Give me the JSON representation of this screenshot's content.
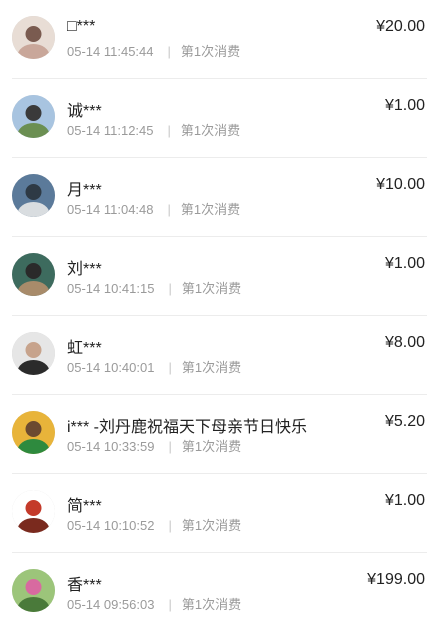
{
  "records": [
    {
      "name": "□***",
      "time": "05-14 11:45:44",
      "sep": "|",
      "count": "第1次消费",
      "amount": "¥20.00",
      "avatar_icon": "user-photo-icon",
      "avatar_colors": [
        "#e8ddd5",
        "#c9a79a",
        "#7a5b50"
      ]
    },
    {
      "name": "诚***",
      "time": "05-14 11:12:45",
      "sep": "|",
      "count": "第1次消费",
      "amount": "¥1.00",
      "avatar_icon": "user-photo-icon",
      "avatar_colors": [
        "#a8c4e0",
        "#6b8f52",
        "#3a3a3a"
      ]
    },
    {
      "name": "月***",
      "time": "05-14 11:04:48",
      "sep": "|",
      "count": "第1次消费",
      "amount": "¥10.00",
      "avatar_icon": "tree-photo-icon",
      "avatar_colors": [
        "#5b7a9a",
        "#d9dde0",
        "#2e3a45"
      ]
    },
    {
      "name": "刘***",
      "time": "05-14 10:41:15",
      "sep": "|",
      "count": "第1次消费",
      "amount": "¥1.00",
      "avatar_icon": "user-photo-icon",
      "avatar_colors": [
        "#3d6b5e",
        "#a88b6a",
        "#2a2a2a"
      ]
    },
    {
      "name": "虹***",
      "time": "05-14 10:40:01",
      "sep": "|",
      "count": "第1次消费",
      "amount": "¥8.00",
      "avatar_icon": "user-photo-icon",
      "avatar_colors": [
        "#e6e6e6",
        "#2b2b2b",
        "#c7a38c"
      ]
    },
    {
      "name": "i*** -刘丹鹿祝福天下母亲节日快乐",
      "time": "05-14 10:33:59",
      "sep": "|",
      "count": "第1次消费",
      "amount": "¥5.20",
      "avatar_icon": "user-photo-icon",
      "avatar_colors": [
        "#e8b43a",
        "#2e8a3e",
        "#6b4a30"
      ]
    },
    {
      "name": "简***",
      "time": "05-14 10:10:52",
      "sep": "|",
      "count": "第1次消费",
      "amount": "¥1.00",
      "avatar_icon": "user-photo-icon",
      "avatar_colors": [
        "#ffffff",
        "#7a2a1e",
        "#c43a2a"
      ]
    },
    {
      "name": "香***",
      "time": "05-14 09:56:03",
      "sep": "|",
      "count": "第1次消费",
      "amount": "¥199.00",
      "avatar_icon": "user-photo-icon",
      "avatar_colors": [
        "#9cc57a",
        "#4a7a3a",
        "#d86aa0"
      ]
    }
  ]
}
